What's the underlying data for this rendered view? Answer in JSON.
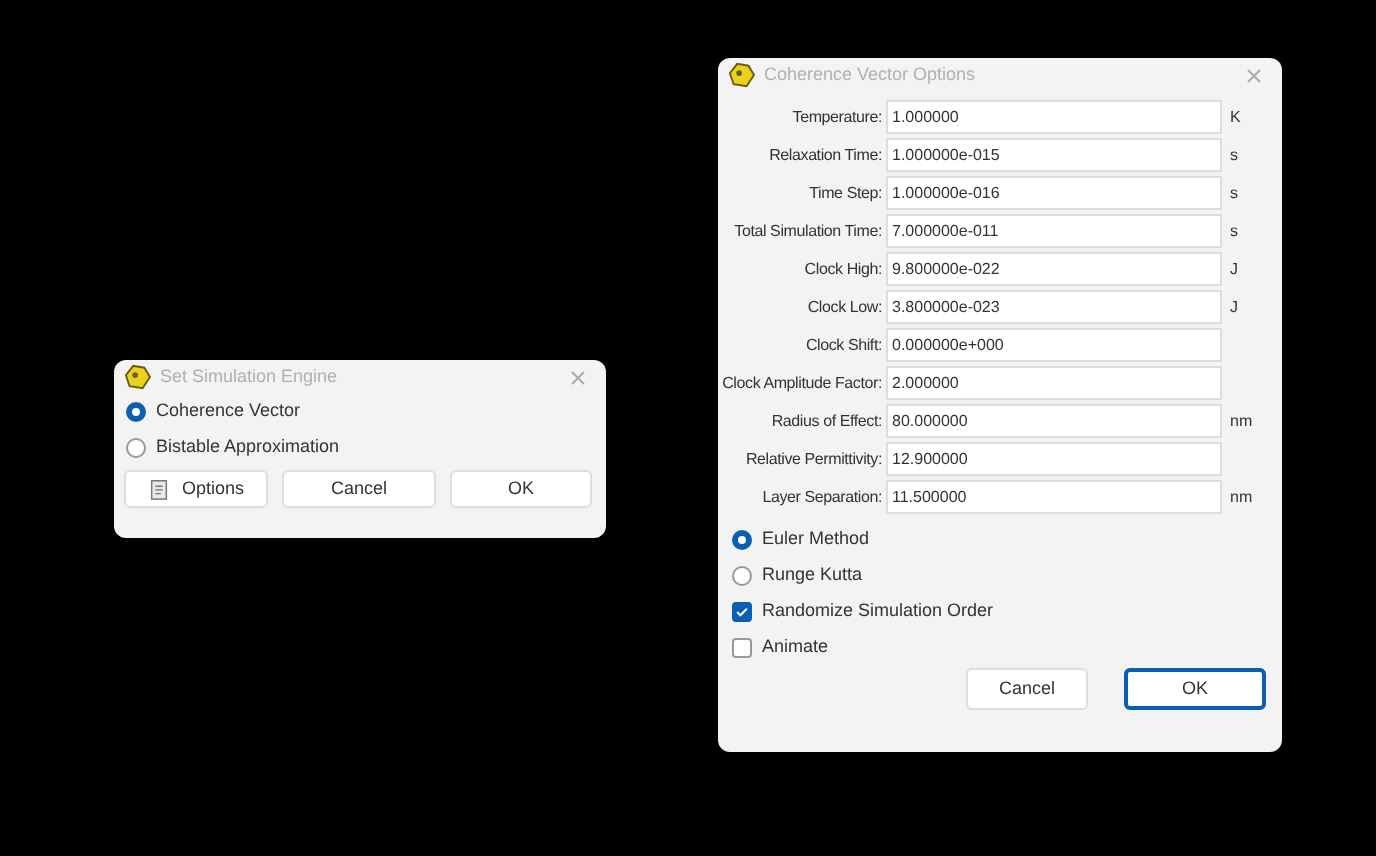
{
  "engine_dialog": {
    "title": "Set Simulation Engine",
    "engines": [
      {
        "label": "Coherence Vector",
        "selected": true
      },
      {
        "label": "Bistable Approximation",
        "selected": false
      }
    ],
    "buttons": [
      {
        "kind": "options",
        "label": "Options"
      },
      {
        "kind": "plain",
        "label": "Cancel"
      },
      {
        "kind": "plain",
        "label": "OK"
      }
    ]
  },
  "options_dialog": {
    "title": "Coherence Vector Options",
    "fields": [
      {
        "label": "Temperature:",
        "value": "1.000000",
        "unit": "K"
      },
      {
        "label": "Relaxation Time:",
        "value": "1.000000e-015",
        "unit": "s"
      },
      {
        "label": "Time Step:",
        "value": "1.000000e-016",
        "unit": "s"
      },
      {
        "label": "Total Simulation Time:",
        "value": "7.000000e-011",
        "unit": "s"
      },
      {
        "label": "Clock High:",
        "value": "9.800000e-022",
        "unit": "J"
      },
      {
        "label": "Clock Low:",
        "value": "3.800000e-023",
        "unit": "J"
      },
      {
        "label": "Clock Shift:",
        "value": "0.000000e+000"
      },
      {
        "label": "Clock Amplitude Factor:",
        "value": "2.000000"
      },
      {
        "label": "Radius of Effect:",
        "value": "80.000000",
        "unit": "nm"
      },
      {
        "label": "Relative Permittivity:",
        "value": "12.900000"
      },
      {
        "label": "Layer Separation:",
        "value": "11.500000",
        "unit": "nm"
      }
    ],
    "methods": [
      {
        "label": "Euler Method",
        "selected": true
      },
      {
        "label": "Runge Kutta",
        "selected": false
      }
    ],
    "checkboxes": [
      {
        "label": "Randomize Simulation Order",
        "checked": true
      },
      {
        "label": "Animate",
        "checked": false
      }
    ],
    "buttons": [
      {
        "label": "Cancel",
        "default": false
      },
      {
        "label": "OK",
        "default": true
      }
    ]
  }
}
